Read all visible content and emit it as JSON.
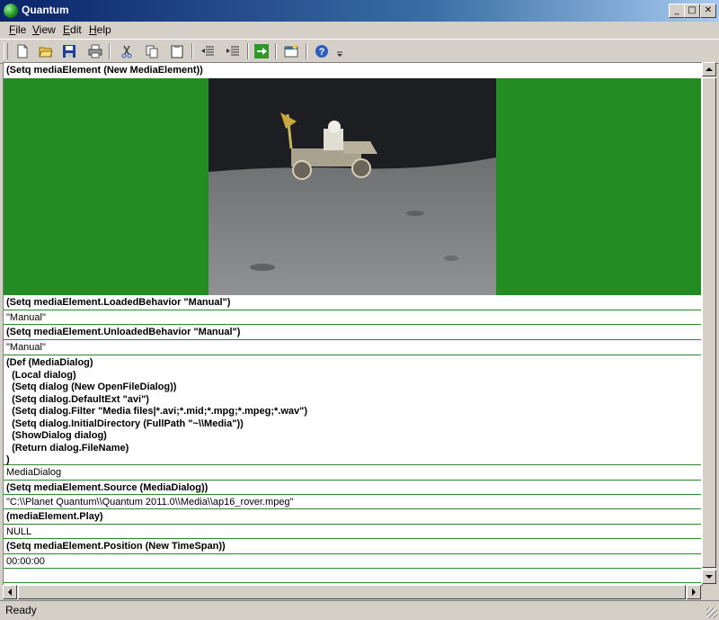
{
  "window": {
    "title": "Quantum",
    "min_glyph": "_",
    "max_glyph": "□",
    "close_glyph": "✕"
  },
  "menu": [
    {
      "label": "File"
    },
    {
      "label": "View"
    },
    {
      "label": "Edit"
    },
    {
      "label": "Help"
    }
  ],
  "toolbar": {
    "icons": [
      "new-document-icon",
      "open-folder-icon",
      "save-icon",
      "print-icon",
      "cut-icon",
      "copy-icon",
      "paste-icon",
      "outdent-icon",
      "indent-icon",
      "run-icon",
      "new-window-icon",
      "help-icon"
    ],
    "colors": {
      "folder": "#f2c94c",
      "save": "#1f3f9a",
      "run": "#2e9a2e",
      "help": "#2a5fc1"
    }
  },
  "cells": [
    {
      "kind": "in",
      "text": "(Setq mediaElement (New MediaElement))"
    },
    {
      "kind": "out",
      "text": "\"Manual\""
    },
    {
      "kind": "in",
      "text": "(Setq mediaElement.LoadedBehavior \"Manual\")"
    },
    {
      "kind": "out",
      "text": "\"Manual\""
    },
    {
      "kind": "in",
      "text": "(Setq mediaElement.UnloadedBehavior \"Manual\")"
    },
    {
      "kind": "in",
      "text": "(Def (MediaDialog)\n  (Local dialog)\n  (Setq dialog (New OpenFileDialog))\n  (Setq dialog.DefaultExt \"avi\")\n  (Setq dialog.Filter \"Media files|*.avi;*.mid;*.mpg;*.mpeg;*.wav\")\n  (Setq dialog.InitialDirectory (FullPath \"~\\\\Media\"))\n  (ShowDialog dialog)\n  (Return dialog.FileName)\n)"
    },
    {
      "kind": "out",
      "text": "MediaDialog"
    },
    {
      "kind": "in",
      "text": "(Setq mediaElement.Source (MediaDialog))"
    },
    {
      "kind": "out",
      "text": "\"C:\\\\Planet Quantum\\\\Quantum 2011.0\\\\Media\\\\ap16_rover.mpeg\""
    },
    {
      "kind": "in",
      "text": "(mediaElement.Play)"
    },
    {
      "kind": "out",
      "text": "NULL"
    },
    {
      "kind": "in",
      "text": "(Setq mediaElement.Position (New TimeSpan))"
    },
    {
      "kind": "out",
      "text": "00:00:00"
    }
  ],
  "media": {
    "background_color": "#238c23"
  },
  "status": {
    "text": "Ready"
  }
}
